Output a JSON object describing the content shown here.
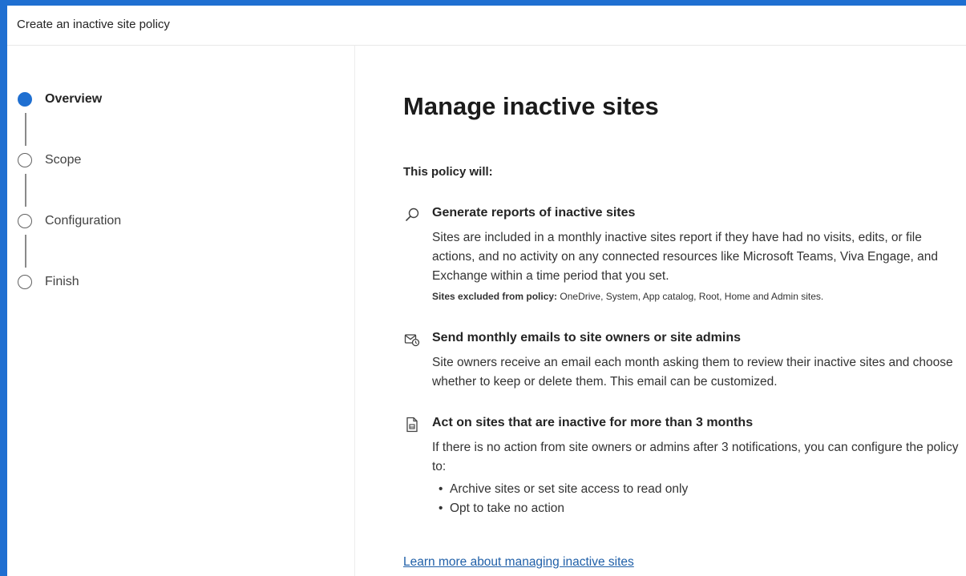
{
  "window": {
    "title": "Create an inactive site policy"
  },
  "steps": [
    {
      "label": "Overview",
      "active": true
    },
    {
      "label": "Scope",
      "active": false
    },
    {
      "label": "Configuration",
      "active": false
    },
    {
      "label": "Finish",
      "active": false
    }
  ],
  "main": {
    "title": "Manage inactive sites",
    "intro": "This policy will:",
    "features": [
      {
        "icon": "search-icon",
        "heading": "Generate reports of inactive sites",
        "description": "Sites are included in a monthly inactive sites report if they have had no visits, edits, or file actions, and no activity on any connected resources like Microsoft Teams, Viva Engage, and Exchange within a time period that you set.",
        "excluded_label": "Sites excluded from policy:",
        "excluded_value": " OneDrive, System, App catalog, Root, Home and Admin sites."
      },
      {
        "icon": "mail-clock-icon",
        "heading": "Send monthly emails to site owners or site admins",
        "description": "Site owners receive an email each month asking them to review their inactive sites and choose whether to keep or delete them. This email can be customized."
      },
      {
        "icon": "document-report-icon",
        "heading": "Act on sites that are inactive for more than 3 months",
        "description": "If there is no action from site owners or admins after 3 notifications, you can configure the policy to:",
        "bullets": [
          "Archive sites or set site access to read only",
          "Opt to take no action"
        ]
      }
    ],
    "learn_more": "Learn more about managing inactive sites"
  },
  "colors": {
    "accent": "#1f6fd1",
    "link": "#1f5fa8"
  }
}
